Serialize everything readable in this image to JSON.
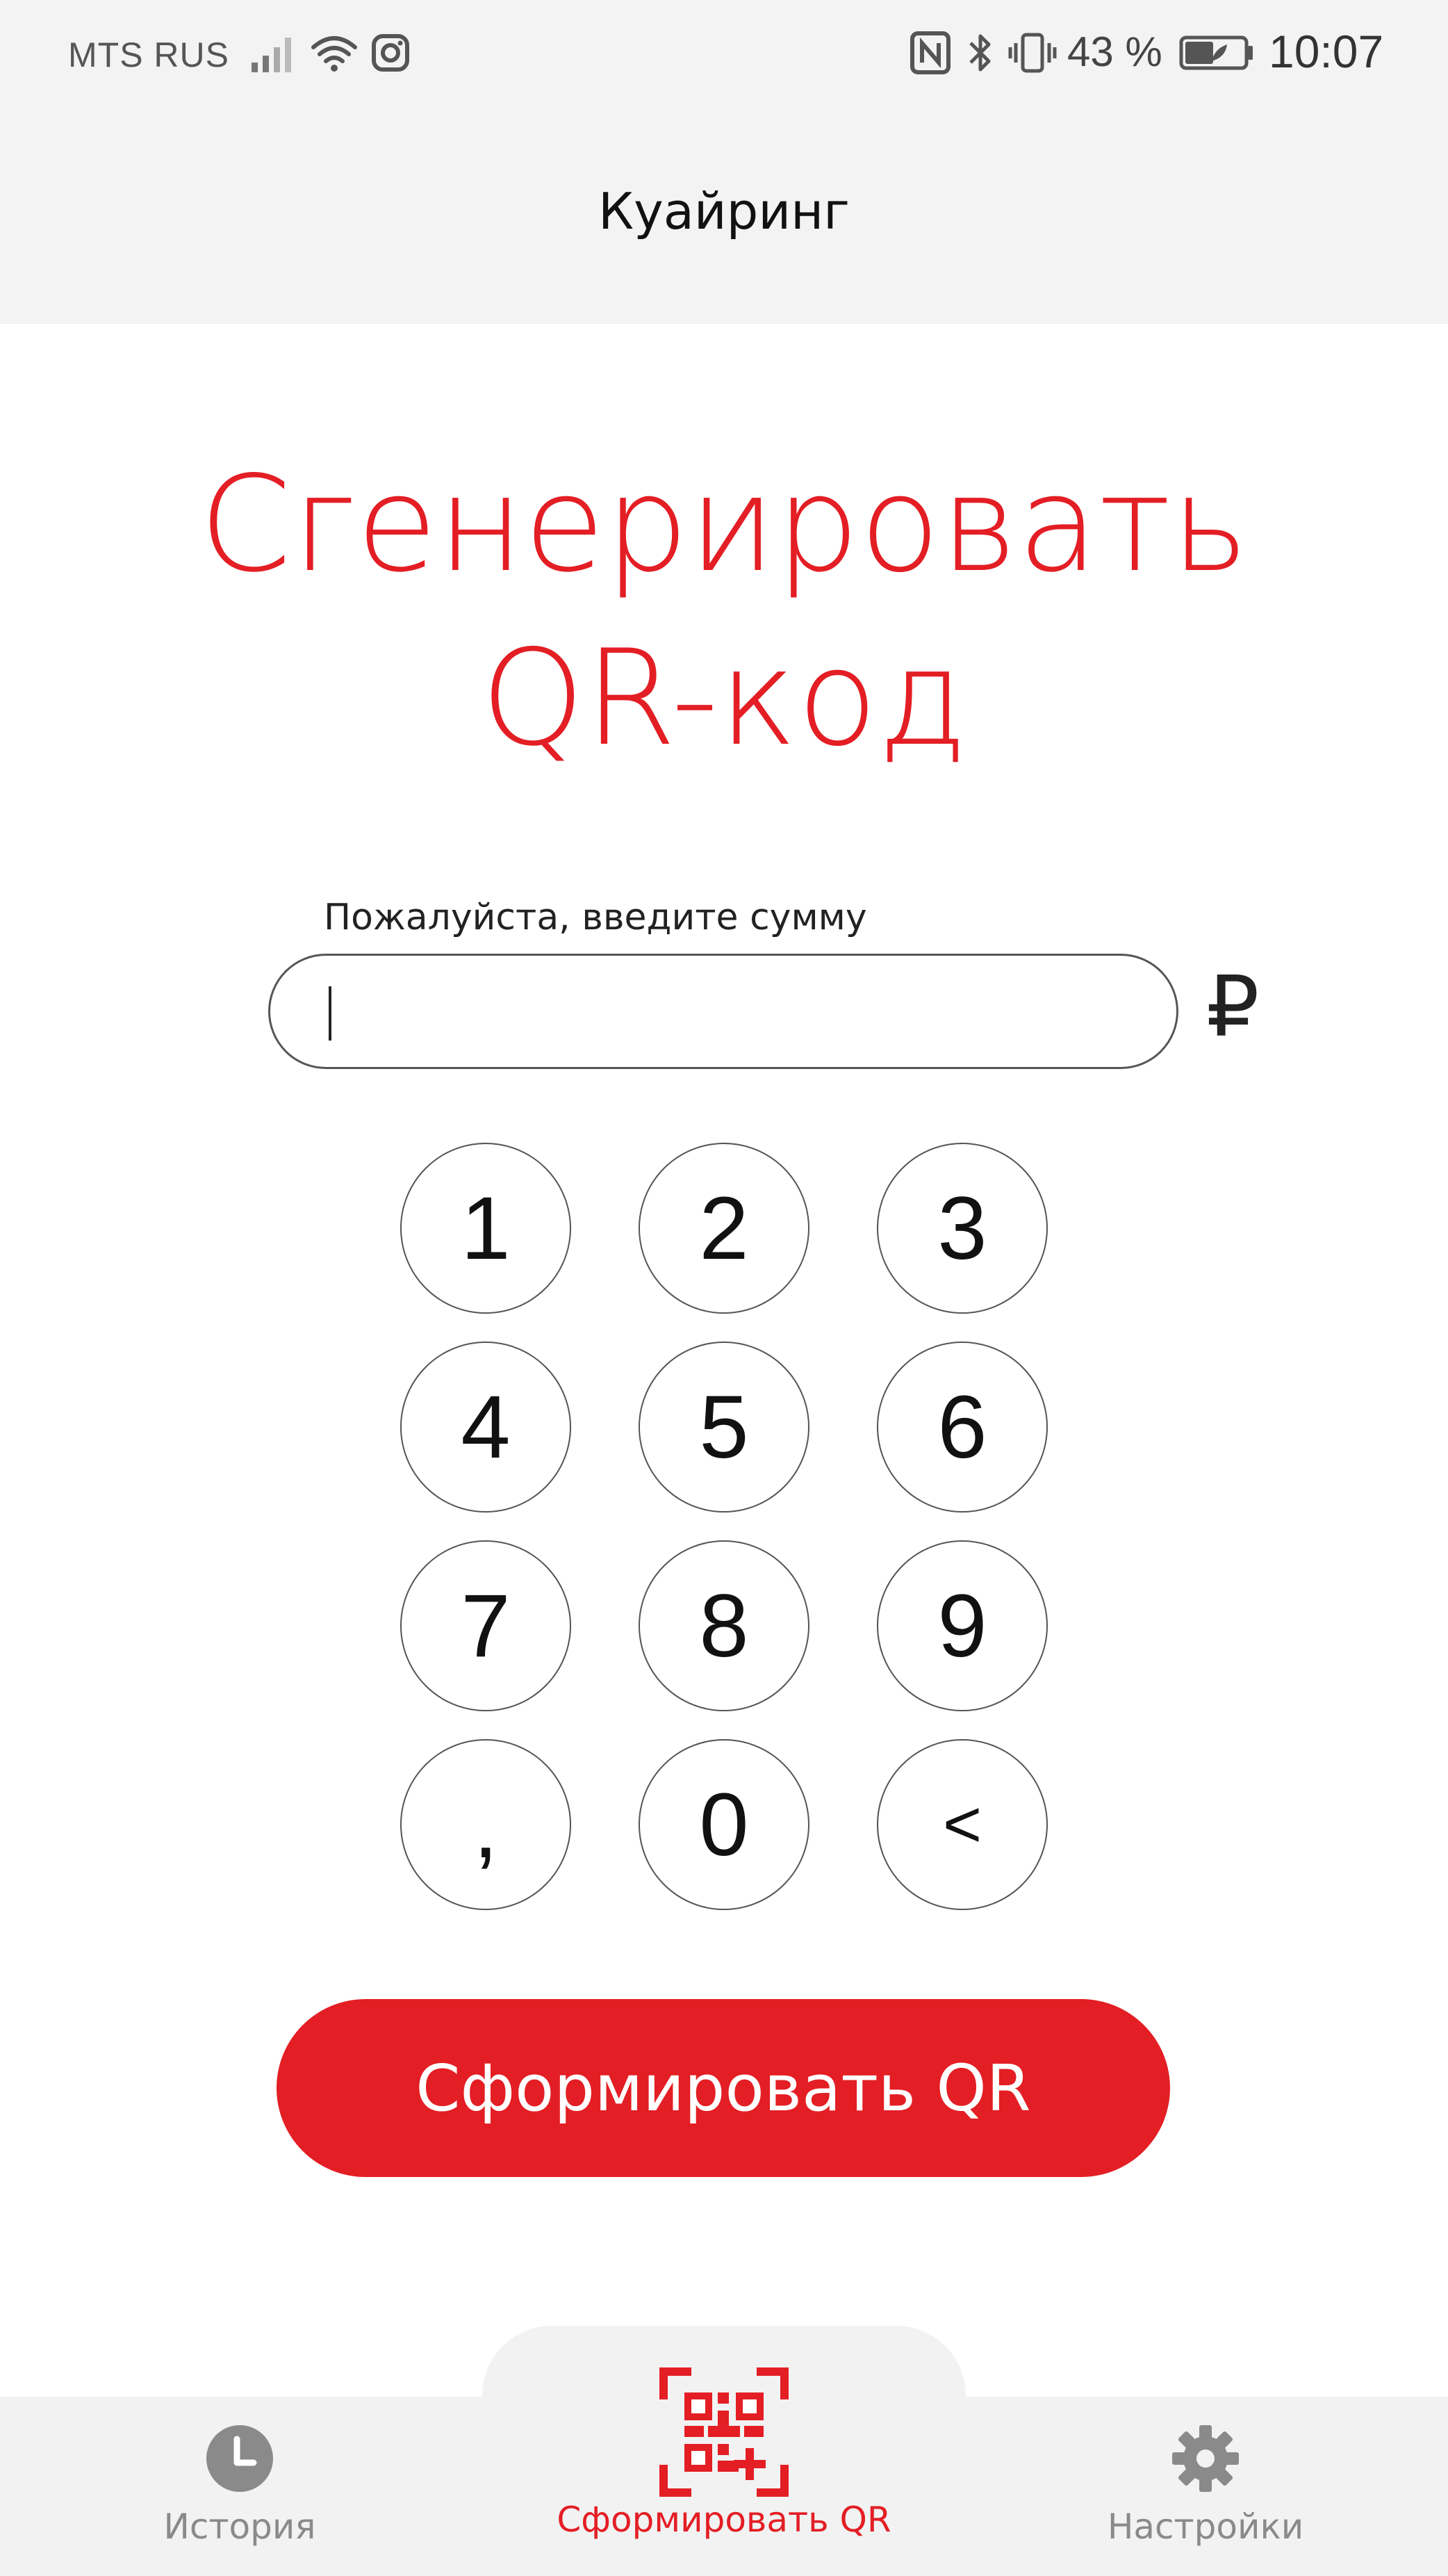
{
  "status_bar": {
    "carrier": "MTS RUS",
    "battery_percent": "43 %",
    "time": "10:07",
    "icons": [
      "signal-icon",
      "wifi-icon",
      "instagram-icon",
      "nfc-icon",
      "bluetooth-icon",
      "vibrate-icon",
      "battery-icon"
    ]
  },
  "app_bar": {
    "title": "Куайринг"
  },
  "main": {
    "heading_line1": "Сгенерировать",
    "heading_line2": "QR-код",
    "amount_label": "Пожалуйста, введите сумму",
    "amount_value": "",
    "currency_symbol": "₽"
  },
  "keypad": {
    "keys": [
      "1",
      "2",
      "3",
      "4",
      "5",
      "6",
      "7",
      "8",
      "9",
      ",",
      "0",
      "<"
    ]
  },
  "cta_label": "Сформировать QR",
  "bottom_nav": {
    "items": [
      {
        "label": "История",
        "icon": "clock-icon",
        "active": false
      },
      {
        "label": "Сформировать QR",
        "icon": "qr-code-icon",
        "active": true
      },
      {
        "label": "Настройки",
        "icon": "gear-icon",
        "active": false
      }
    ]
  },
  "colors": {
    "accent": "#e31e24",
    "background": "#ffffff",
    "bar_background": "#f3f3f4",
    "inactive_nav": "#8a8a8a"
  }
}
